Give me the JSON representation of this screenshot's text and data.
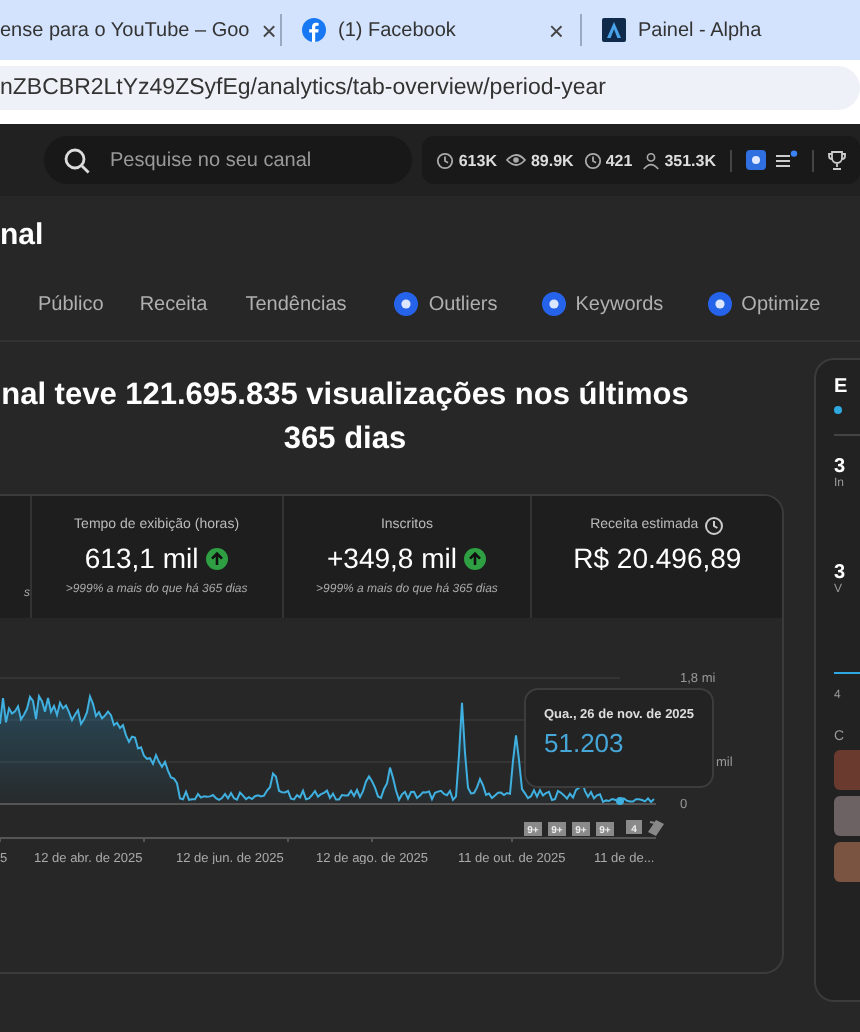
{
  "browser": {
    "tabs": [
      {
        "title": "ense para o YouTube – Goo",
        "kind": "generic",
        "close": "×"
      },
      {
        "title": "(1) Facebook",
        "kind": "facebook",
        "close": "×"
      },
      {
        "title": "Painel - Alpha",
        "kind": "alpha"
      }
    ],
    "address": "nZBCBR2LtYz49ZSyfEg/analytics/tab-overview/period-year"
  },
  "header": {
    "search": {
      "placeholder": "Pesquise no seu canal"
    },
    "stats": [
      {
        "kind": "clock",
        "value": "613K"
      },
      {
        "kind": "eye",
        "value": "89.9K"
      },
      {
        "kind": "clock",
        "value": "421"
      },
      {
        "kind": "person",
        "value": "351.3K"
      }
    ]
  },
  "channel_title": "nal",
  "nav_tabs": [
    {
      "label": "Público",
      "kind": "plain"
    },
    {
      "label": "Receita",
      "kind": "plain"
    },
    {
      "label": "Tendências",
      "kind": "plain"
    },
    {
      "label": "Outliers",
      "kind": "tool"
    },
    {
      "label": "Keywords",
      "kind": "tool"
    },
    {
      "label": "Optimize",
      "kind": "tool"
    }
  ],
  "headline": "nal teve 121.695.835 visualizações nos últimos 365 dias",
  "metrics": [
    {
      "subtext": "s"
    },
    {
      "label": "Tempo de exibição (horas)",
      "value": "613,1 mil",
      "rising": true,
      "subtext": ">999% a mais do que há 365 dias"
    },
    {
      "label": "Inscritos",
      "value": "+349,8 mil",
      "rising": true,
      "subtext": ">999% a mais do que há 365 dias"
    },
    {
      "label": "Receita estimada",
      "value": "R$ 20.496,89",
      "estimated": true
    }
  ],
  "chart": {
    "y_labels": [
      "1,8 mi",
      "mil",
      "0"
    ],
    "x_labels": [
      "5",
      "12 de abr. de 2025",
      "12 de jun. de 2025",
      "12 de ago. de 2025",
      "11 de out. de 2025",
      "11 de de..."
    ],
    "badges": [
      "9+",
      "9+",
      "9+",
      "9+",
      "4"
    ],
    "tooltip": {
      "date": "Qua., 26 de nov. de 2025",
      "value": "51.203"
    }
  },
  "side_panel": {
    "title": "E",
    "stats": [
      {
        "value": "3",
        "caption": "In"
      },
      {
        "value": "3",
        "caption": "V"
      }
    ],
    "axis_label": "4",
    "section": "C",
    "swatches": [
      {
        "color": "#6a3a2e"
      },
      {
        "color": "#6c6163"
      },
      {
        "color": "#7a5440"
      }
    ]
  }
}
